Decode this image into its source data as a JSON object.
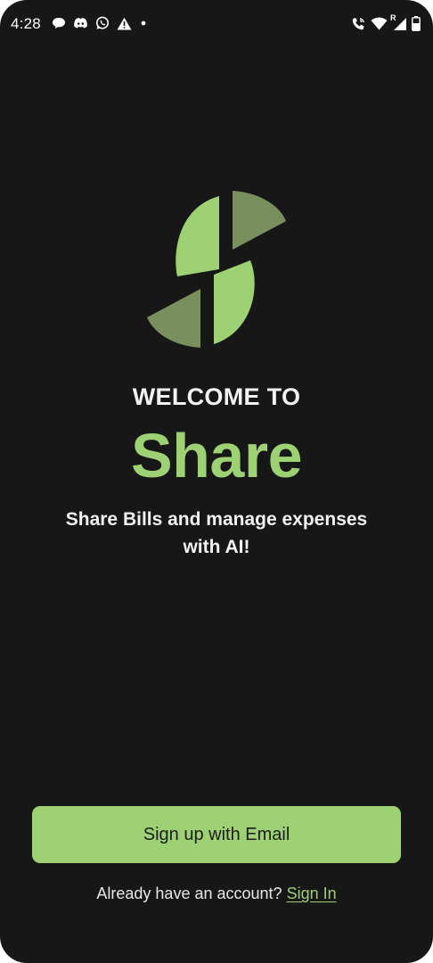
{
  "status_bar": {
    "time": "4:28",
    "left_icons": [
      "chat-bubble-icon",
      "discord-icon",
      "whatsapp-icon",
      "warning-icon",
      "dot-icon"
    ],
    "right_icons": [
      "wifi-calling-icon",
      "wifi-icon",
      "cell-signal-roaming-icon",
      "battery-icon"
    ],
    "roaming_indicator": "R"
  },
  "logo": {
    "icon": "share-s-logo",
    "colors": {
      "bright": "#9dd173",
      "muted": "#7a8f5e"
    }
  },
  "welcome": {
    "heading": "WELCOME TO",
    "app_name": "Share",
    "tagline": "Share Bills and manage expenses with AI!"
  },
  "actions": {
    "signup_label": "Sign up with Email",
    "signin_prompt": "Already have an account?",
    "signin_link": "Sign In"
  },
  "colors": {
    "background": "#171717",
    "accent": "#9dd173",
    "text": "#f2f2f2"
  }
}
